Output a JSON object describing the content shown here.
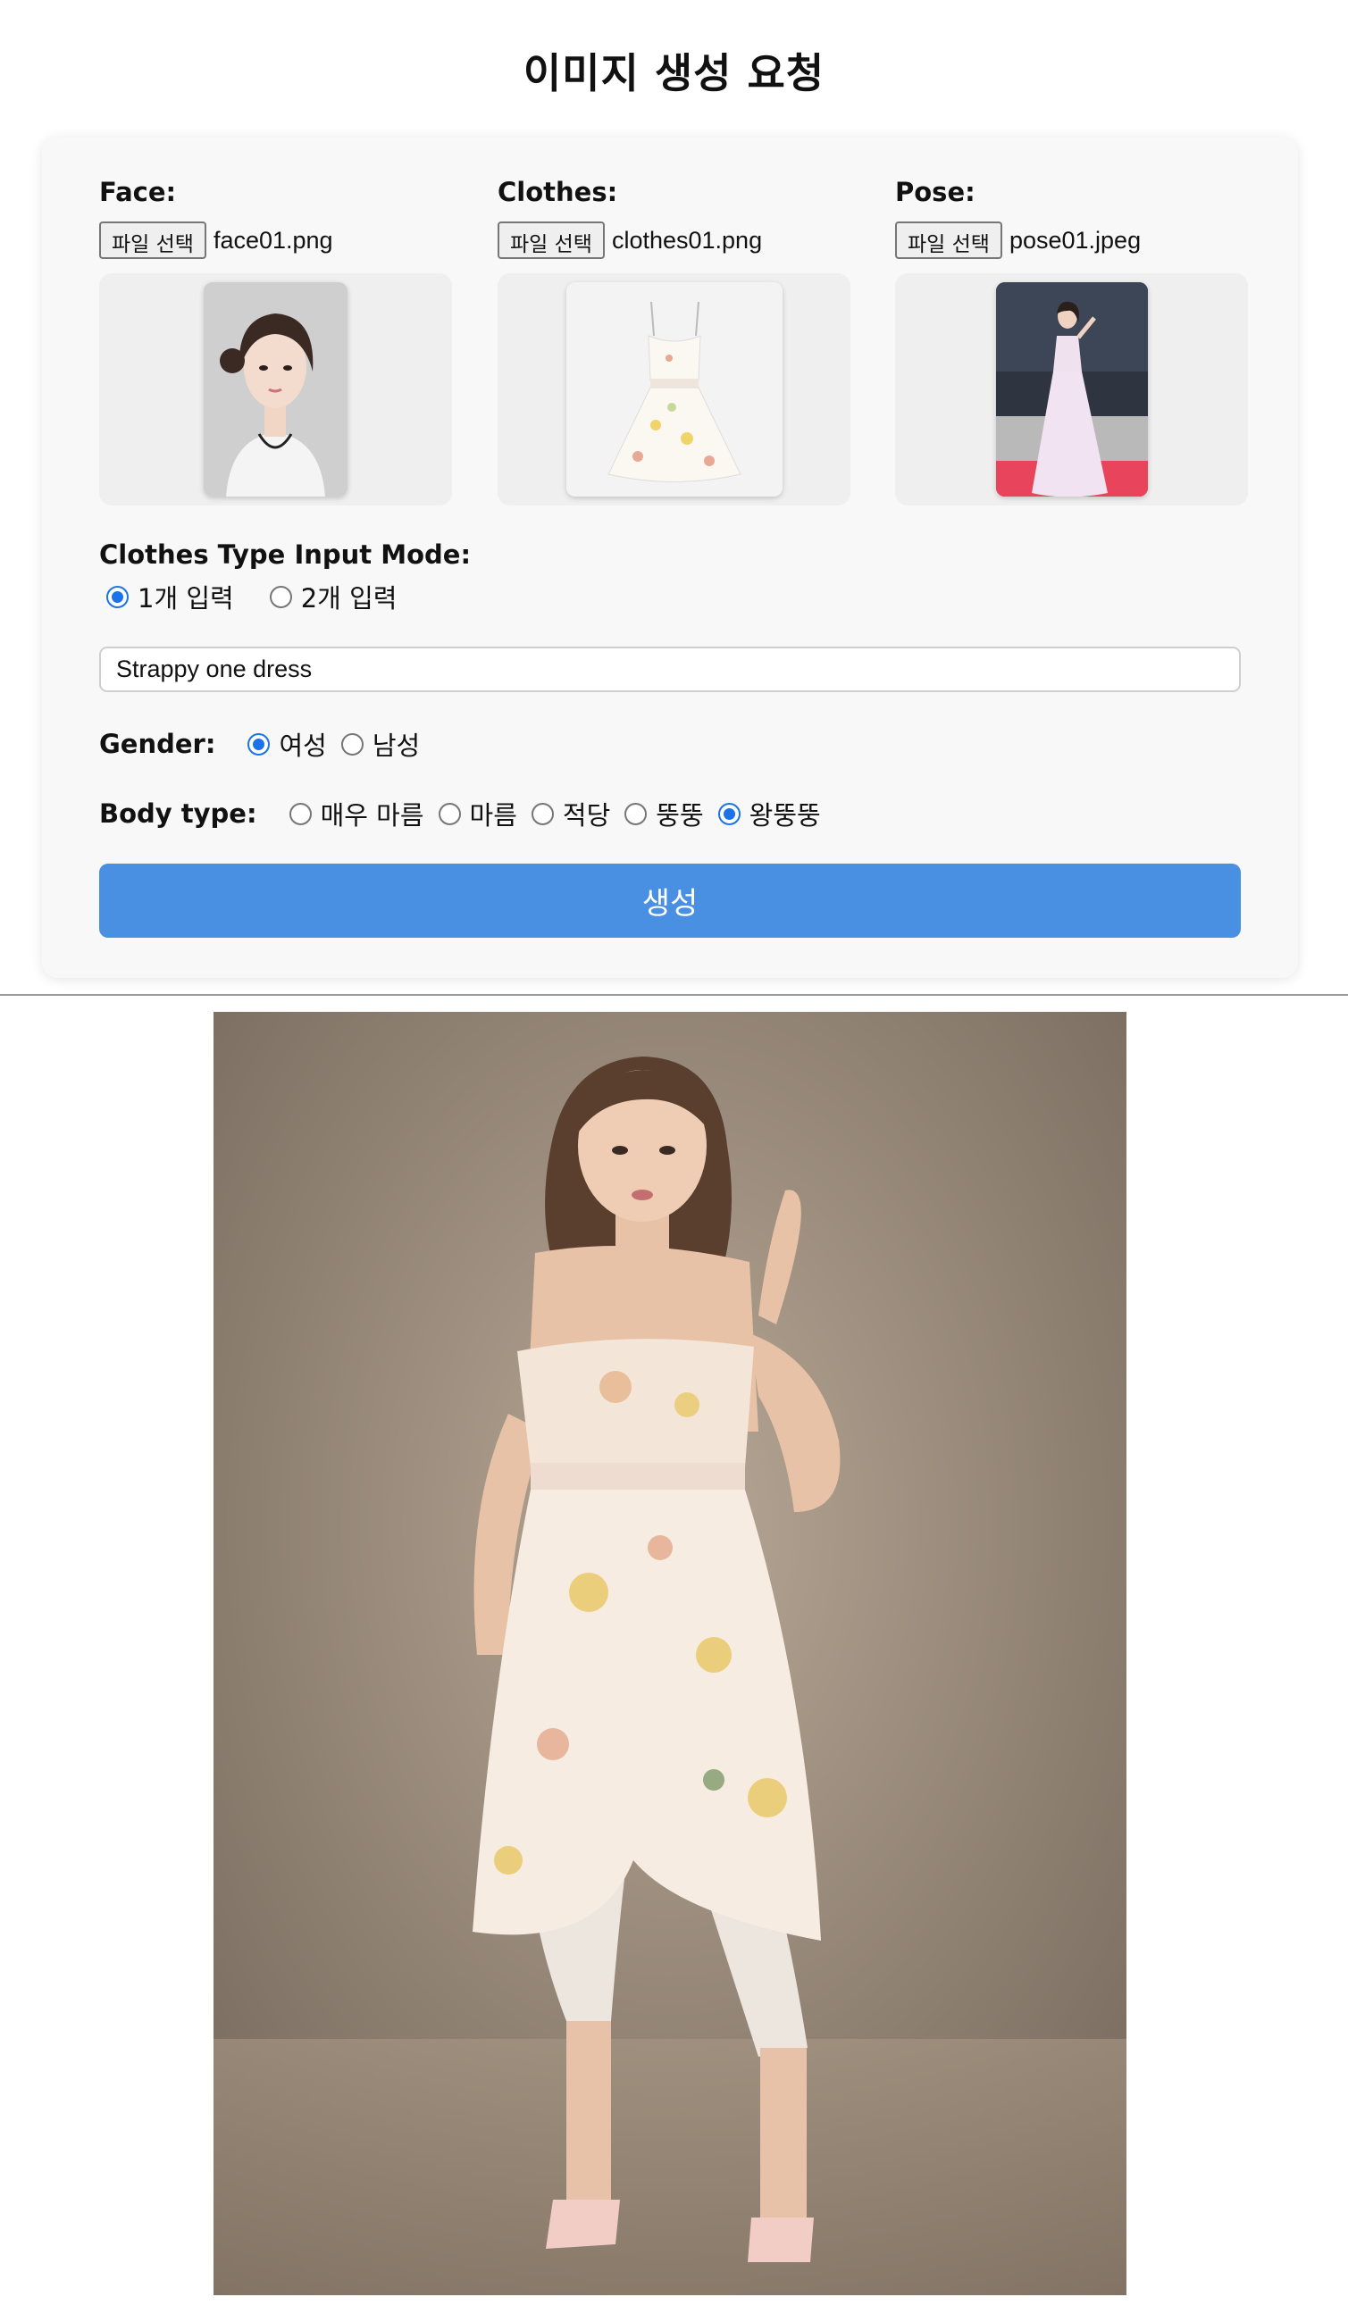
{
  "page": {
    "title": "이미지 생성 요청"
  },
  "uploads": [
    {
      "label": "Face:",
      "button": "파일 선택",
      "filename": "face01.png"
    },
    {
      "label": "Clothes:",
      "button": "파일 선택",
      "filename": "clothes01.png"
    },
    {
      "label": "Pose:",
      "button": "파일 선택",
      "filename": "pose01.jpeg"
    }
  ],
  "clothes_mode": {
    "label": "Clothes Type Input Mode:",
    "options": [
      "1개 입력",
      "2개 입력"
    ],
    "selected": "1개 입력"
  },
  "clothes_text": {
    "value": "Strappy one dress"
  },
  "gender": {
    "label": "Gender:",
    "options": [
      "여성",
      "남성"
    ],
    "selected": "여성"
  },
  "body_type": {
    "label": "Body type:",
    "options": [
      "매우 마름",
      "마름",
      "적당",
      "뚱뚱",
      "왕뚱뚱"
    ],
    "selected": "왕뚱뚱"
  },
  "submit": {
    "label": "생성"
  },
  "colors": {
    "accent": "#4a90e2",
    "radio": "#1a73e8",
    "card": "#f8f8f8"
  }
}
